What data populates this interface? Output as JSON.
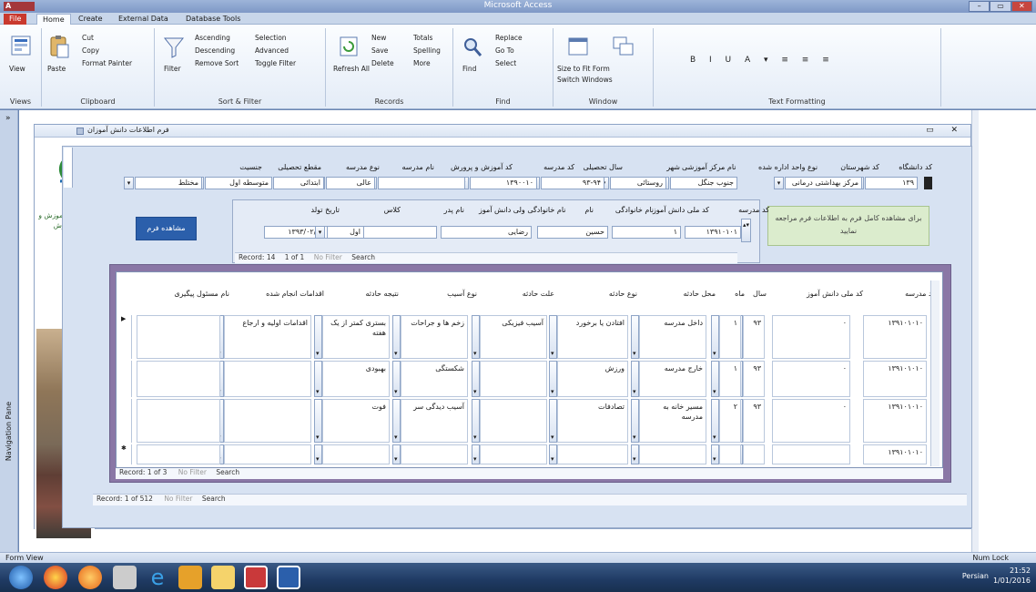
{
  "window": {
    "app_logo": "A",
    "title": "Microsoft Access",
    "controls": [
      "–",
      "▭",
      "✕"
    ]
  },
  "tabs": [
    {
      "label": "File",
      "active": false,
      "file": true
    },
    {
      "label": "Home",
      "active": true
    },
    {
      "label": "Create",
      "active": false
    },
    {
      "label": "External Data",
      "active": false
    },
    {
      "label": "Database Tools",
      "active": false
    }
  ],
  "ribbon": {
    "views": {
      "label": "View",
      "group": "Views"
    },
    "clipboard": {
      "paste": "Paste",
      "cut": "Cut",
      "copy": "Copy",
      "format_painter": "Format Painter",
      "group": "Clipboard"
    },
    "sort_filter": {
      "filter": "Filter",
      "ascending": "Ascending",
      "descending": "Descending",
      "remove_sort": "Remove Sort",
      "selection": "Selection",
      "advanced": "Advanced",
      "toggle_filter": "Toggle Filter",
      "group": "Sort & Filter"
    },
    "records": {
      "refresh": "Refresh All",
      "new": "New",
      "save": "Save",
      "delete": "Delete",
      "totals": "Totals",
      "spelling": "Spelling",
      "more": "More",
      "group": "Records"
    },
    "find": {
      "find": "Find",
      "replace": "Replace",
      "goto": "Go To",
      "select": "Select",
      "group": "Find"
    },
    "window": {
      "size_to_fit": "Size to Fit Form",
      "switch_windows": "Switch Windows",
      "group": "Window"
    },
    "text_formatting": {
      "group": "Text Formatting"
    }
  },
  "nav_pane": {
    "label": "Navigation Pane"
  },
  "form": {
    "title": "فرم اطلاعات دانش آموزان",
    "logo_text": "سازمان آموزش و پرورش",
    "header_labels": [
      "کد دانشگاه",
      "کد شهرستان",
      "نوع واحد اداره شده",
      "نام مرکز آموزشی",
      "شهر",
      "سال تحصیلی",
      "کد مدرسه",
      "کد آموزش و پرورش",
      "نام مدرسه",
      "نوع مدرسه",
      "مقطع تحصیلی",
      "جنسیت"
    ],
    "header_values": [
      "۱۳۹",
      "مرکز بهداشتی درمانی",
      "جنوب جنگل",
      "روستائی",
      "۹۳-۹۴",
      "۱۳۹۰۰۱۰",
      "",
      "عالی",
      "ابتدائی",
      "متوسطه اول",
      "مختلط"
    ],
    "sub1_labels": [
      "کد مدرسه",
      "کد ملی دانش آموز",
      "نام خانوادگی",
      "نام",
      "نام خانوادگی ولی دانش آموز",
      "نام پدر",
      "کلاس",
      "تاریخ تولد"
    ],
    "sub1_values": [
      "۱۳۹۱۰۱۰۱",
      "۱",
      "حسین",
      "رضایی",
      "",
      "اول",
      "۱۳۹۳/۰۲/۱۲"
    ],
    "blue_button": "مشاهده فرم",
    "green_note": "برای مشاهده کامل فرم به اطلاعات فرم مراجعه نمایید",
    "record_nav1": {
      "record": "Record: 14",
      "of": "1 of 1",
      "no_filter": "No Filter",
      "search": "Search"
    },
    "grid_headers": [
      "کد مدرسه",
      "کد ملی دانش آموز",
      "سال",
      "ماه",
      "محل حادثه",
      "نوع حادثه",
      "علت حادثه",
      "نوع آسیب",
      "نتیجه حادثه",
      "اقدامات انجام شده",
      "نام مسئول پیگیری"
    ],
    "grid_rows": [
      {
        "school": "۱۳۹۱۰۱۰۱۰",
        "nid": "۰",
        "year": "۹۳",
        "month": "۱",
        "place": "داخل مدرسه",
        "type": "افتادن یا برخورد",
        "cause": "آسیب فیزیکی",
        "injury": "زخم ها و جراحات",
        "result": "بستری کمتر از یک هفته",
        "actions": "اقدامات اولیه و ارجاع",
        "resp": ""
      },
      {
        "school": "۱۳۹۱۰۱۰۱۰",
        "nid": "۰",
        "year": "۹۳",
        "month": "۱",
        "place": "خارج مدرسه",
        "type": "ورزش",
        "cause": "",
        "injury": "شکستگی",
        "result": "بهبودی",
        "actions": "",
        "resp": ""
      },
      {
        "school": "۱۳۹۱۰۱۰۱۰",
        "nid": "۰",
        "year": "۹۳",
        "month": "۲",
        "place": "مسیر خانه به مدرسه",
        "type": "تصادفات",
        "cause": "",
        "injury": "آسیب دیدگی سر",
        "result": "فوت",
        "actions": "",
        "resp": ""
      },
      {
        "school": "۱۳۹۱۰۱۰۱۰",
        "nid": "",
        "year": "",
        "month": "",
        "place": "",
        "type": "",
        "cause": "",
        "injury": "",
        "result": "",
        "actions": "",
        "resp": ""
      }
    ],
    "record_nav2": {
      "record": "Record: 1 of 3",
      "no_filter": "No Filter",
      "search": "Search"
    },
    "record_nav3": {
      "record": "Record: 1 of 512",
      "no_filter": "No Filter",
      "search": "Search"
    }
  },
  "status": {
    "left": "Form View",
    "right": "Num Lock"
  },
  "taskbar": {
    "language": "Persian",
    "time": "21:52",
    "date": "1/01/2016"
  }
}
